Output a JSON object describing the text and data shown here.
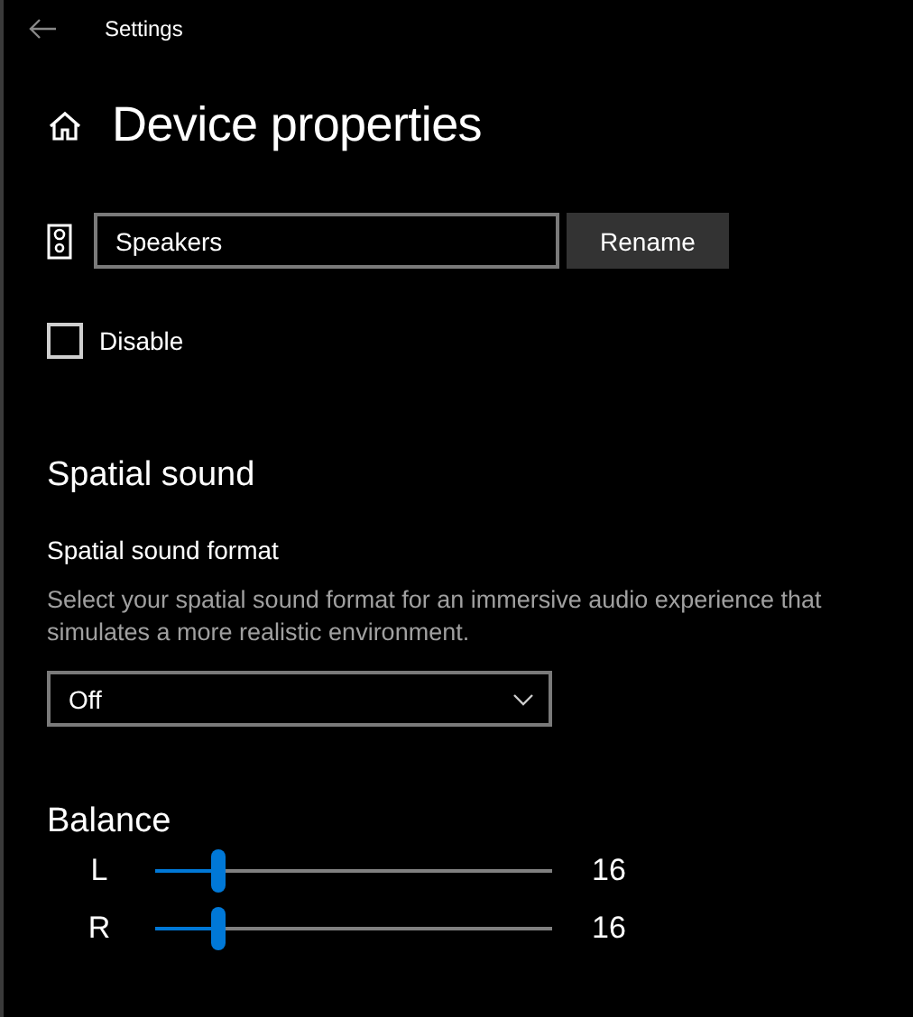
{
  "window": {
    "title": "Settings"
  },
  "page": {
    "title": "Device properties"
  },
  "device": {
    "name_value": "Speakers",
    "rename_button": "Rename"
  },
  "disable": {
    "label": "Disable",
    "checked": false
  },
  "spatial_sound": {
    "heading": "Spatial sound",
    "format_label": "Spatial sound format",
    "description": "Select your spatial sound format for an immersive audio experience that simulates a more realistic environment.",
    "dropdown_value": "Off"
  },
  "balance": {
    "heading": "Balance",
    "channels": [
      {
        "label": "L",
        "level": 0.16,
        "reading": "16"
      },
      {
        "label": "R",
        "level": 0.16,
        "reading": "16"
      }
    ]
  }
}
